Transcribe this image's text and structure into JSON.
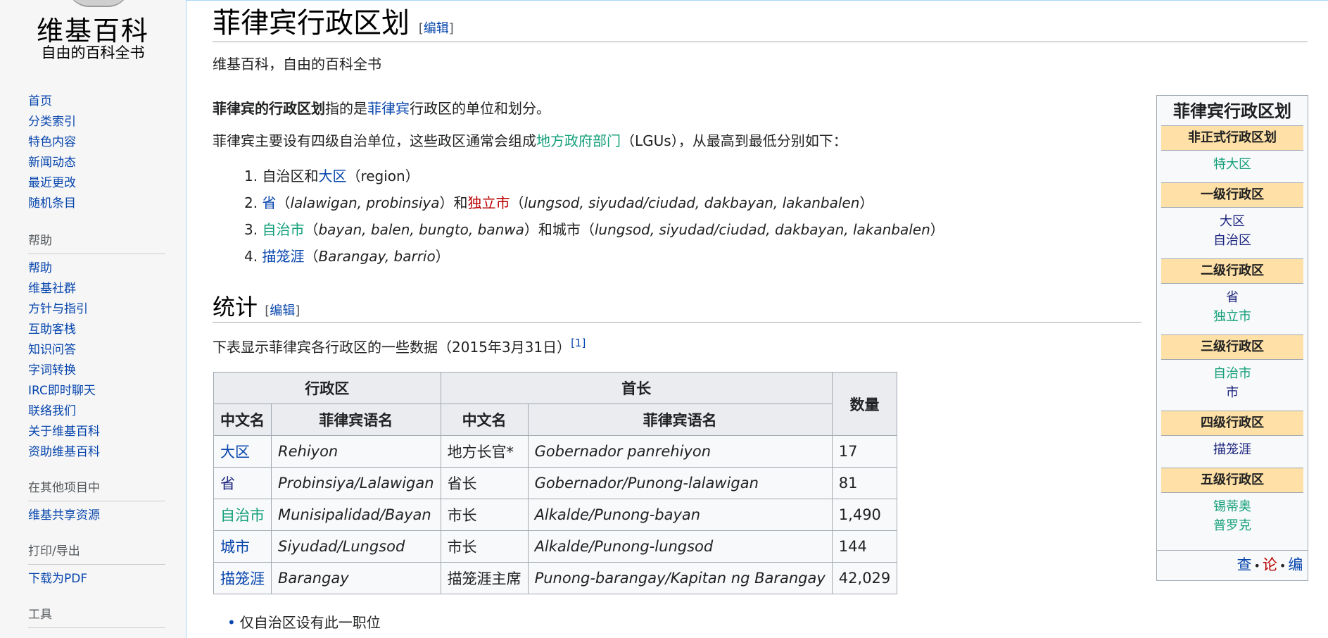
{
  "sidebar": {
    "logo_title": "维基百科",
    "logo_subtitle": "自由的百科全书",
    "nav_main": [
      "首页",
      "分类索引",
      "特色内容",
      "新闻动态",
      "最近更改",
      "随机条目"
    ],
    "help_heading": "帮助",
    "nav_help": [
      "帮助",
      "维基社群",
      "方针与指引",
      "互助客栈",
      "知识问答",
      "字词转换",
      "IRC即时聊天",
      "联络我们",
      "关于维基百科",
      "资助维基百科"
    ],
    "other_heading": "在其他项目中",
    "nav_other": [
      "维基共享资源"
    ],
    "print_heading": "打印/导出",
    "nav_print": [
      "下载为PDF"
    ],
    "tools_heading": "工具"
  },
  "article": {
    "title": "菲律宾行政区划",
    "edit_label": "编辑",
    "tagline": "维基百科，自由的百科全书",
    "lead_bold": "菲律宾的行政区划",
    "lead_mid": "指的是",
    "lead_link": "菲律宾",
    "lead_end": "行政区的单位和划分。",
    "p2_start": "菲律宾主要设有四级自治单位，这些政区通常会组成",
    "p2_link": "地方政府部门",
    "p2_end": "（LGUs），从最高到最低分别如下：",
    "list": {
      "i1_num": "1.",
      "i1_a": "自治区和",
      "i1_link": "大区",
      "i1_b": "（region）",
      "i2_num": "2.",
      "i2_link": "省",
      "i2_a": "（",
      "i2_it": "lalawigan, probinsiya",
      "i2_b": "）和",
      "i2_link2": "独立市",
      "i2_c": "（",
      "i2_it2": "lungsod, siyudad/ciudad, dakbayan, lakanbalen",
      "i2_d": "）",
      "i3_num": "3.",
      "i3_link": "自治市",
      "i3_a": "（",
      "i3_it": "bayan, balen, bungto, banwa",
      "i3_b": "）和城市（",
      "i3_it2": "lungsod, siyudad/ciudad, dakbayan, lakanbalen",
      "i3_c": "）",
      "i4_num": "4.",
      "i4_link": "描笼涯",
      "i4_a": "（",
      "i4_it": "Barangay, barrio",
      "i4_b": "）"
    },
    "section_title": "统计",
    "section_edit_open": "[",
    "section_edit_close": "]",
    "stats_intro": "下表显示菲律宾各行政区的一些数据（2015年3月31日）",
    "stats_ref": "[1]",
    "footnote": "仅自治区设有此一职位",
    "footnote_bullet": "•"
  },
  "table": {
    "group_headers": [
      "行政区",
      "首长",
      "数量"
    ],
    "sub_headers": [
      "中文名",
      "菲律宾语名",
      "中文名",
      "菲律宾语名"
    ],
    "rows": [
      {
        "name": "大区",
        "name_color": "blue",
        "tl": "Rehiyon",
        "head_zh": "地方长官*",
        "head_tl": "Gobernador panrehiyon",
        "count": "17"
      },
      {
        "name": "省",
        "name_color": "navy",
        "tl": "Probinsiya/Lalawigan",
        "head_zh": "省长",
        "head_tl": "Gobernador/Punong-lalawigan",
        "count": "81"
      },
      {
        "name": "自治市",
        "name_color": "green",
        "tl": "Munisipalidad/Bayan",
        "head_zh": "市长",
        "head_tl": "Alkalde/Punong-bayan",
        "count": "1,490"
      },
      {
        "name": "城市",
        "name_color": "blue",
        "tl": "Siyudad/Lungsod",
        "head_zh": "市长",
        "head_tl": "Alkalde/Punong-lungsod",
        "count": "144"
      },
      {
        "name": "描笼涯",
        "name_color": "blue",
        "tl": "Barangay",
        "head_zh": "描笼涯主席",
        "head_tl": "Punong-barangay/Kapitan ng Barangay",
        "count": "42,029"
      }
    ]
  },
  "navbox": {
    "title": "菲律宾行政区划",
    "groups": [
      {
        "heading": "非正式行政区划",
        "items": [
          {
            "label": "特大区",
            "color": "green"
          }
        ]
      },
      {
        "heading": "一级行政区",
        "items": [
          {
            "label": "大区",
            "color": "navy"
          },
          {
            "label": "自治区",
            "color": "navy"
          }
        ]
      },
      {
        "heading": "二级行政区",
        "items": [
          {
            "label": "省",
            "color": "navy"
          },
          {
            "label": "独立市",
            "color": "green"
          }
        ]
      },
      {
        "heading": "三级行政区",
        "items": [
          {
            "label": "自治市",
            "color": "green"
          },
          {
            "label": "市",
            "color": "navy"
          }
        ]
      },
      {
        "heading": "四级行政区",
        "items": [
          {
            "label": "描笼涯",
            "color": "navy"
          }
        ]
      },
      {
        "heading": "五级行政区",
        "items": [
          {
            "label": "锡蒂奥",
            "color": "green"
          },
          {
            "label": "普罗克",
            "color": "green"
          }
        ]
      }
    ],
    "footer_view": "查",
    "footer_talk": "论",
    "footer_edit": "编",
    "footer_sep": "•"
  },
  "colors": {
    "link": "#0645ad",
    "green_link": "#14a07a",
    "red_link": "#ba0000",
    "navbox_head": "#ffe0a6"
  }
}
